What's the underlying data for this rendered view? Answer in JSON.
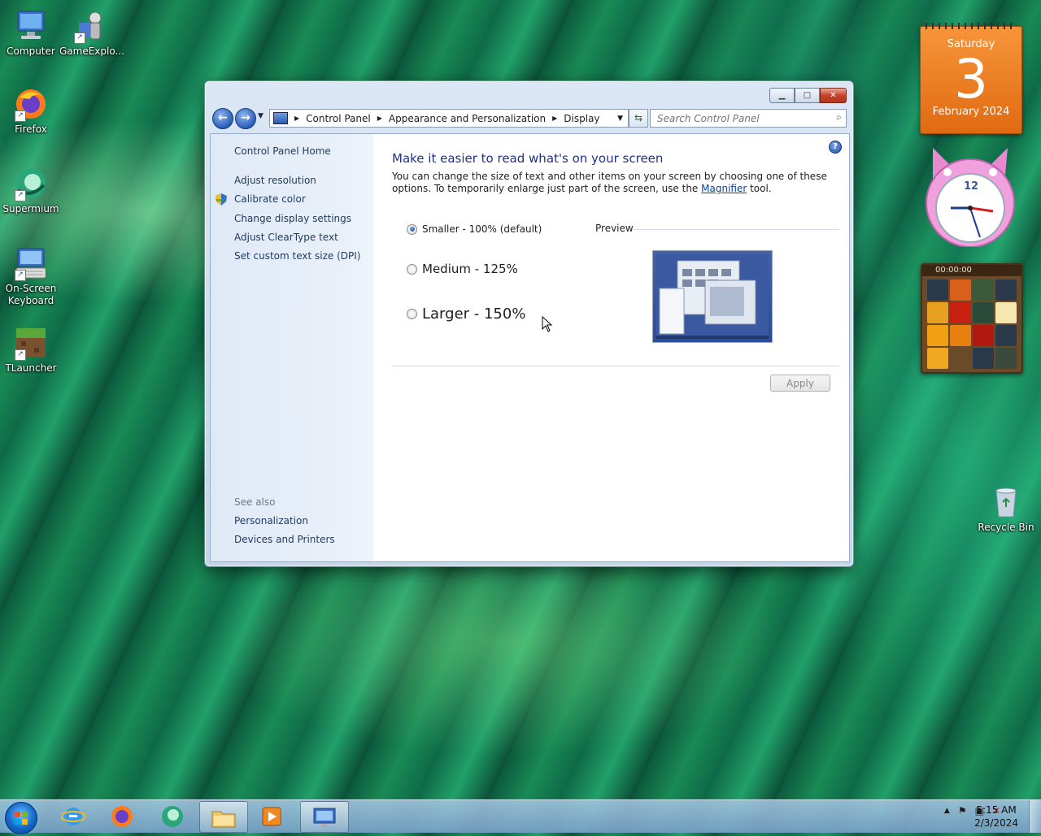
{
  "desktop": {
    "icons": [
      {
        "label": "Computer"
      },
      {
        "label": "GameExplo..."
      },
      {
        "label": "Firefox"
      },
      {
        "label": "Supermium"
      },
      {
        "label": "On-Screen Keyboard"
      },
      {
        "label": "TLauncher"
      },
      {
        "label": "Recycle Bin"
      }
    ]
  },
  "gadgets": {
    "calendar": {
      "weekday": "Saturday",
      "day": "3",
      "month_year": "February 2024"
    },
    "clock": {
      "twelve": "12"
    },
    "puzzle": {
      "timer": "00:00:00"
    }
  },
  "window": {
    "address": {
      "crumbs": [
        "Control Panel",
        "Appearance and Personalization",
        "Display"
      ]
    },
    "search": {
      "placeholder": "Search Control Panel"
    },
    "sidebar": {
      "home": "Control Panel Home",
      "links": [
        "Adjust resolution",
        "Calibrate color",
        "Change display settings",
        "Adjust ClearType text",
        "Set custom text size (DPI)"
      ],
      "see_also_title": "See also",
      "see_also": [
        "Personalization",
        "Devices and Printers"
      ]
    },
    "main": {
      "heading": "Make it easier to read what's on your screen",
      "desc_pre": "You can change the size of text and other items on your screen by choosing one of these options. To temporarily enlarge just part of the screen, use the ",
      "desc_link": "Magnifier",
      "desc_post": " tool.",
      "options": [
        {
          "label": "Smaller - 100% (default)",
          "selected": true
        },
        {
          "label": "Medium - 125%",
          "selected": false
        },
        {
          "label": "Larger - 150%",
          "selected": false
        }
      ],
      "preview_label": "Preview",
      "apply_label": "Apply"
    }
  },
  "taskbar": {
    "time": "5:15 AM",
    "date": "2/3/2024"
  }
}
